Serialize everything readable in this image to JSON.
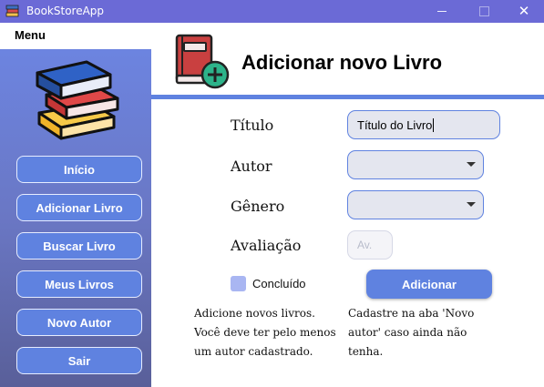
{
  "window": {
    "title": "BookStoreApp",
    "close_glyph": "✕"
  },
  "sidebar": {
    "title": "Menu",
    "logo_icon": "books-stack-icon",
    "items": [
      {
        "label": "Início"
      },
      {
        "label": "Adicionar Livro"
      },
      {
        "label": "Buscar Livro"
      },
      {
        "label": "Meus Livros"
      },
      {
        "label": "Novo Autor"
      },
      {
        "label": "Sair"
      }
    ]
  },
  "header": {
    "title": "Adicionar novo Livro",
    "icon": "book-add-icon"
  },
  "form": {
    "title_label": "Título",
    "title_value": "Título do Livro",
    "author_label": "Autor",
    "author_value": "",
    "genre_label": "Gênero",
    "genre_value": "",
    "rating_label": "Avaliação",
    "rating_placeholder": "Av.",
    "completed_label": "Concluído",
    "completed_checked": false,
    "submit_label": "Adicionar"
  },
  "help": {
    "left": "Adicione novos livros.\nVocê deve ter pelo menos\num autor cadastrado.",
    "right": "Cadastre na aba 'Novo\nautor' caso ainda não\ntenha."
  },
  "colors": {
    "titlebar": "#6b6ad6",
    "accent": "#5f82e0",
    "sidebar_top": "#6c84e0",
    "sidebar_bottom": "#595f99",
    "input_bg": "#e4e6ef",
    "checkbox": "#a9b6f2"
  }
}
